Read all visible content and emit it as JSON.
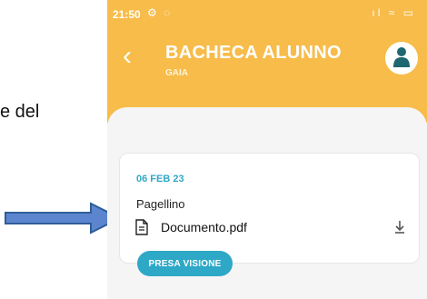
{
  "side_text": {
    "fragment": "e del"
  },
  "status_bar": {
    "time": "21:50",
    "left_icons": "⚙ ◌",
    "right_icons": "ıl ≈ ▭"
  },
  "header": {
    "back_icon": "‹",
    "title": "BACHECA ALUNNO",
    "subtitle": "GAIA"
  },
  "notice": {
    "date": "06 FEB 23",
    "title": "Pagellino",
    "attachment_name": "Documento.pdf",
    "action_label": "PRESA VISIONE"
  },
  "colors": {
    "header": "#f7bc49",
    "accent": "#2ea8c7",
    "arrow_fill": "#5b86cf",
    "arrow_stroke": "#2e5d98"
  }
}
